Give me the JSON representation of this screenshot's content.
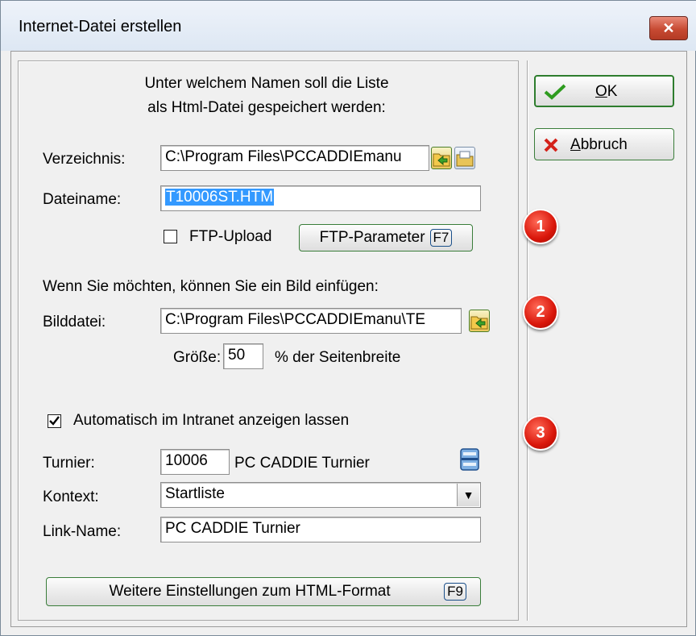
{
  "window": {
    "title": "Internet-Datei erstellen",
    "close_label": "✕"
  },
  "intro": {
    "line1": "Unter welchem Namen soll die Liste",
    "line2": "als Html-Datei gespeichert werden:"
  },
  "verzeichnis": {
    "label": "Verzeichnis:",
    "value": "C:\\Program Files\\PCCADDIEmanu"
  },
  "dateiname": {
    "label": "Dateiname:",
    "value": "T10006ST.HTM"
  },
  "ftp": {
    "upload_label": "FTP-Upload",
    "upload_checked": false,
    "param_label": "FTP-Parameter",
    "param_key": "F7"
  },
  "bild": {
    "heading": "Wenn Sie möchten, können Sie ein Bild einfügen:",
    "label": "Bilddatei:",
    "value": "C:\\Program Files\\PCCADDIEmanu\\TE",
    "size_label": "Größe:",
    "size_value": "50",
    "size_suffix": "% der Seitenbreite"
  },
  "intranet": {
    "auto_label": "Automatisch im Intranet anzeigen lassen",
    "auto_checked": true,
    "turnier_label": "Turnier:",
    "turnier_value": "10006",
    "turnier_name": "PC CADDIE Turnier",
    "kontext_label": "Kontext:",
    "kontext_value": "Startliste",
    "linkname_label": "Link-Name:",
    "linkname_value": "PC CADDIE Turnier"
  },
  "html_format": {
    "label": "Weitere Einstellungen zum HTML-Format",
    "key": "F9"
  },
  "actions": {
    "ok_mnemonic": "O",
    "ok_rest": "K",
    "cancel_mnemonic": "A",
    "cancel_rest": "bbruch"
  },
  "badges": [
    "1",
    "2",
    "3"
  ],
  "colors": {
    "ok_check": "#2e9b1f",
    "cancel_x": "#d4221a",
    "badge_red": "#d9160a",
    "selection_blue": "#3399ff",
    "button_border_green": "#3a7d3a"
  }
}
